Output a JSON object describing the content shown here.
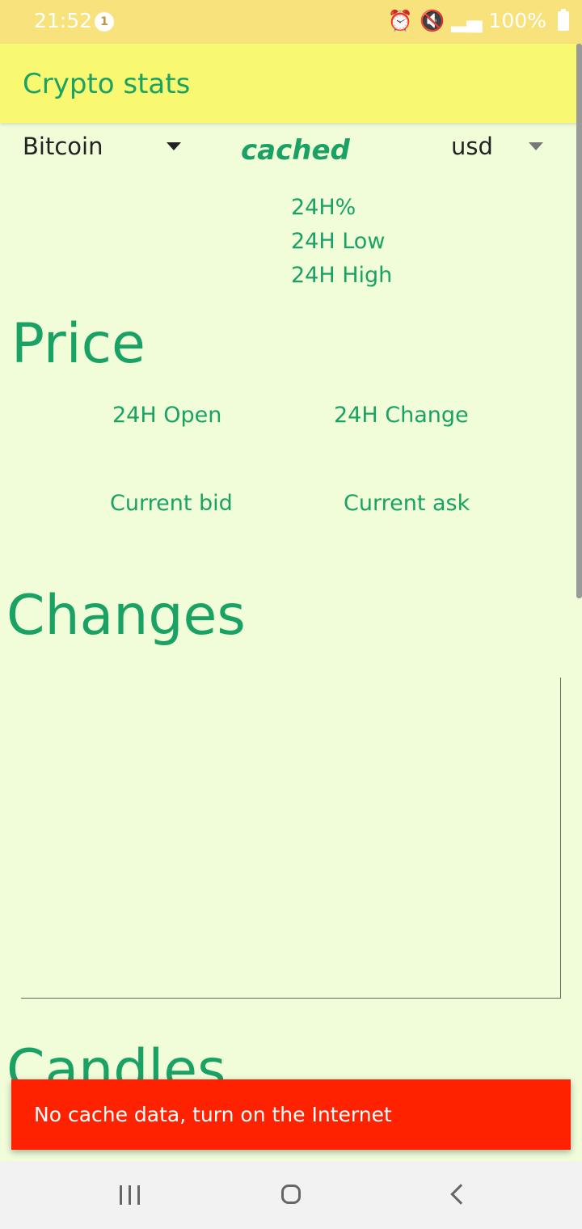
{
  "status_bar": {
    "time": "21:52",
    "notification_count": "1",
    "battery": "100%"
  },
  "app_bar": {
    "title": "Crypto stats"
  },
  "coin_select": {
    "selected": "Bitcoin"
  },
  "cache_status": "cached",
  "currency_select": {
    "selected": "usd"
  },
  "stats": {
    "change_24h_pct": "24H%",
    "low_24h": "24H Low",
    "high_24h": "24H High"
  },
  "price_heading": "Price",
  "open_24h": "24H Open",
  "change_24h": "24H Change",
  "current_bid": "Current bid",
  "current_ask": "Current ask",
  "changes_heading": "Changes",
  "candles_heading": "Candles",
  "snackbar": {
    "message": "No cache data, turn on the Internet"
  },
  "colors": {
    "accent": "#1aa264",
    "app_bar": "#f8f871",
    "background": "#f1fcd9",
    "status_bar": "#f8e27c",
    "snackbar": "#ff2200"
  }
}
